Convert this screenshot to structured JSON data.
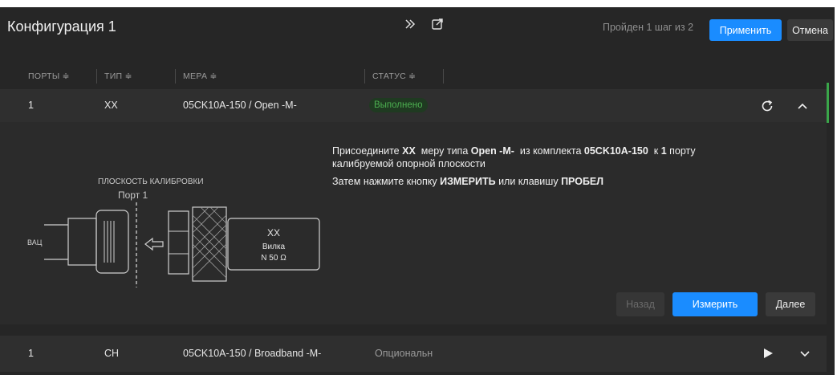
{
  "header": {
    "title": "Конфигурация 1",
    "steps_text": "Пройден 1 шаг из 2",
    "apply_label": "Применить",
    "cancel_label": "Отмена"
  },
  "columns": [
    {
      "label": "ПОРТЫ ≑"
    },
    {
      "label": "ТИП ≑"
    },
    {
      "label": "МЕРА ≑"
    },
    {
      "label": "СТАТУС ≑"
    }
  ],
  "rows": [
    {
      "port": "1",
      "type": "XX",
      "standard": "05CK10A-150 / Open -M-",
      "status": "Выполнено"
    },
    {
      "port": "1",
      "type": "CH",
      "standard": "05CK10A-150 / Broadband -M-",
      "status": "Опциональн"
    }
  ],
  "diagram": {
    "plane_label": "ПЛОСКОСТЬ КАЛИБРОВКИ",
    "port_label": "Порт 1",
    "vna_label": "ВАЦ",
    "kit_type": "XX",
    "kit_gender": "Вилка",
    "kit_impedance": "N 50 Ω"
  },
  "instructions": {
    "l1_a": "Присоедините",
    "l1_type": "XX",
    "l1_b": "меру типа",
    "l1_std": "Open -M-",
    "l1_c": "из комплекта",
    "l1_kit": "05CK10A-150",
    "l1_d": "к",
    "l1_port": "1",
    "l1_e": "порту",
    "l2": "калибруемой опорной плоскости",
    "l3_a": "Затем нажмите кнопку",
    "l3_btn": "ИЗМЕРИТЬ",
    "l3_b": "или клавишу",
    "l3_key": "ПРОБЕЛ"
  },
  "actions": {
    "back_label": "Назад",
    "measure_label": "Измерить",
    "next_label": "Далее"
  },
  "colors": {
    "accent": "#1a8cff",
    "success": "#4caf50",
    "background": "#262626"
  },
  "icons": [
    "double-chevron-right-icon",
    "external-link-icon",
    "refresh-icon",
    "chevron-up-icon",
    "play-icon",
    "chevron-down-icon"
  ]
}
